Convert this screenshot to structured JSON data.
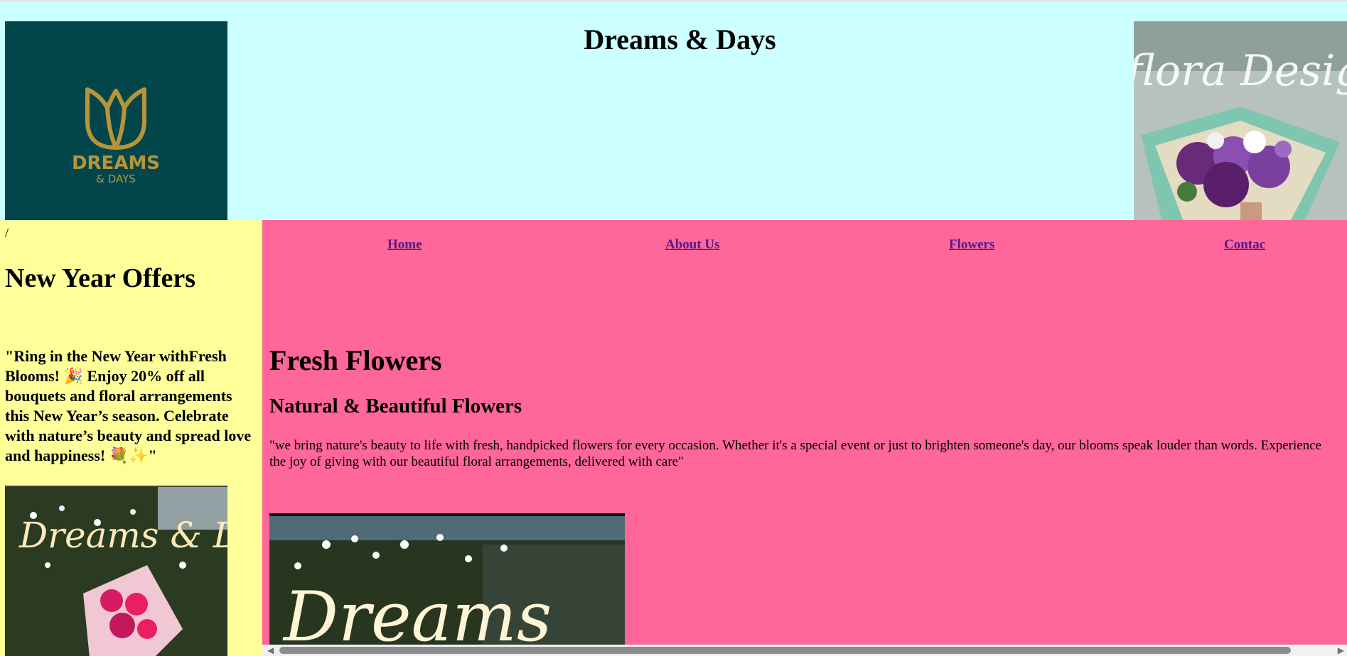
{
  "header": {
    "title": "Dreams & Days",
    "logo": {
      "line1": "DREAMS",
      "line2": "& DAYS",
      "icon": "tulip-outline-icon",
      "bg_color": "#02464c",
      "fg_color": "#b89439"
    },
    "photo_label": "flora Design",
    "bg_color": "#ccffff"
  },
  "sidebar": {
    "slash": "/",
    "title": "New Year Offers",
    "offer_text": "\"Ring in the New Year withFresh Blooms! 🎉 Enjoy 20% off all bouquets and floral arrangements this New Year’s season. Celebrate with nature’s beauty and spread love and happiness! 💐✨\"",
    "photo_label": "Dreams & Days",
    "bg_color": "#ffff99"
  },
  "nav": {
    "home": "Home",
    "about": "About Us",
    "flowers": "Flowers",
    "contact": "Contac"
  },
  "main": {
    "heading": "Fresh Flowers",
    "subheading": "Natural & Beautiful Flowers",
    "intro": "\"we bring nature's beauty to life with fresh, handpicked flowers for every occasion. Whether it's a special event or just to brighten someone's day, our blooms speak louder than words. Experience the joy of giving with our beautiful floral arrangements, delivered with care\"",
    "photo_label": "Dreams",
    "bg_color": "#ff6699"
  },
  "scrollbar": {
    "left_arrow": "◀",
    "right_arrow": "▶"
  }
}
